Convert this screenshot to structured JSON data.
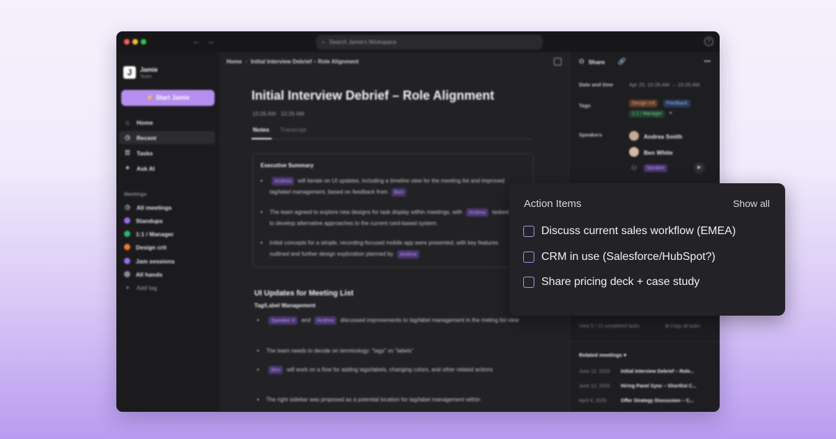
{
  "titlebar": {
    "search_placeholder": "Search Jamie's Workspace",
    "back_icon": "arrow-left-icon",
    "forward_icon": "arrow-right-icon",
    "traffic_colors": [
      "#ff5f57",
      "#febc2e",
      "#28c840"
    ]
  },
  "sidebar": {
    "workspace_name": "Jamie",
    "workspace_sub": "Team",
    "start_button": "Start Jamie",
    "nav": [
      {
        "label": "Home",
        "icon": "home-icon"
      },
      {
        "label": "Recent",
        "icon": "clock-icon",
        "active": true
      },
      {
        "label": "Tasks",
        "icon": "tasks-icon"
      },
      {
        "label": "Ask AI",
        "icon": "sparkle-icon"
      }
    ],
    "meetings_label": "Meetings",
    "meetings": [
      {
        "label": "All meetings",
        "color": "#c8c8cc"
      },
      {
        "label": "Standups",
        "color": "#9b6cf0"
      },
      {
        "label": "1:1 / Manager",
        "color": "#2fb86a"
      },
      {
        "label": "Design crit",
        "color": "#f07a2a"
      },
      {
        "label": "Jam sessions",
        "color": "#9b6cf0"
      },
      {
        "label": "All hands",
        "color": "#8a8a90"
      },
      {
        "label": "Add tag",
        "color": "#8a8a90"
      }
    ]
  },
  "main": {
    "breadcrumb": [
      "Home",
      "Initial Interview Debrief – Role Alignment"
    ],
    "title": "Initial Interview Debrief – Role Alignment",
    "time": "10:26 AM  ·  10:26 AM",
    "tabs": [
      "Notes",
      "Transcript"
    ],
    "summary": {
      "title": "Executive Summary",
      "bullets": [
        {
          "pill": "Andrea",
          "text": "will iterate on UI updates, including a timeline view for the meeting list and improved tag/label management, based on feedback from",
          "pill2": "Ben"
        },
        {
          "text": "The team agreed to explore new designs for task display within meetings, with",
          "pill": "Andrea",
          "text2": "tasked to develop alternative approaches to the current card-based system."
        },
        {
          "text": "Initial concepts for a simple, recording-focused mobile app were presented, with key features outlined and further design exploration planned by",
          "pill": "Andrea"
        }
      ]
    },
    "section_title": "UI Updates for Meeting List",
    "subsection_title": "Tag/Label Management",
    "bullets": [
      {
        "pill": "Speaker 0",
        "mid": "and",
        "pill2": "Andrea",
        "text": "discussed improvements to tag/label management in the meting list view"
      },
      {
        "text": "The team needs to decide on terminology: \"tags\" vs \"labels\""
      },
      {
        "pill": "Ben",
        "text": "will work on a flow for adding tags/labels, changing colors, and other related actions"
      },
      {
        "text": "The right sidebar was proposed as a potential location for tag/label management within"
      }
    ]
  },
  "right_panel": {
    "share_label": "Share",
    "date_label": "Date and time",
    "date_value": "Apr 25, 10:26 AM  →  10:26 AM",
    "tags_label": "Tags",
    "tags": [
      {
        "label": "Design crit",
        "bg": "#5a3a2a",
        "fg": "#f0a070"
      },
      {
        "label": "Feedback",
        "bg": "#2a3a5a",
        "fg": "#8ab0f0"
      },
      {
        "label": "1:1 / Manager",
        "bg": "#23402e",
        "fg": "#6ad08e"
      }
    ],
    "speakers_label": "Speakers",
    "speakers": [
      "Andrea Smith",
      "Ben White"
    ],
    "speaker_pill": "Speaker",
    "tasks_summary": "View 5 / 12 completed tasks",
    "copy_tasks": "Copy all tasks",
    "related_label": "Related meetings",
    "related": [
      {
        "date": "June 12, 2025",
        "title": "Initial Interview Debrief – Role..."
      },
      {
        "date": "June 12, 2025",
        "title": "Hiring Panel Sync – Shortlist C..."
      },
      {
        "date": "April 4, 2025",
        "title": "Offer Strategy Discussion – C..."
      }
    ]
  },
  "action_card": {
    "title": "Action Items",
    "show_all": "Show all",
    "items": [
      "Discuss current sales workflow (EMEA)",
      "CRM in use (Salesforce/HubSpot?)",
      "Share pricing deck + case study"
    ]
  }
}
